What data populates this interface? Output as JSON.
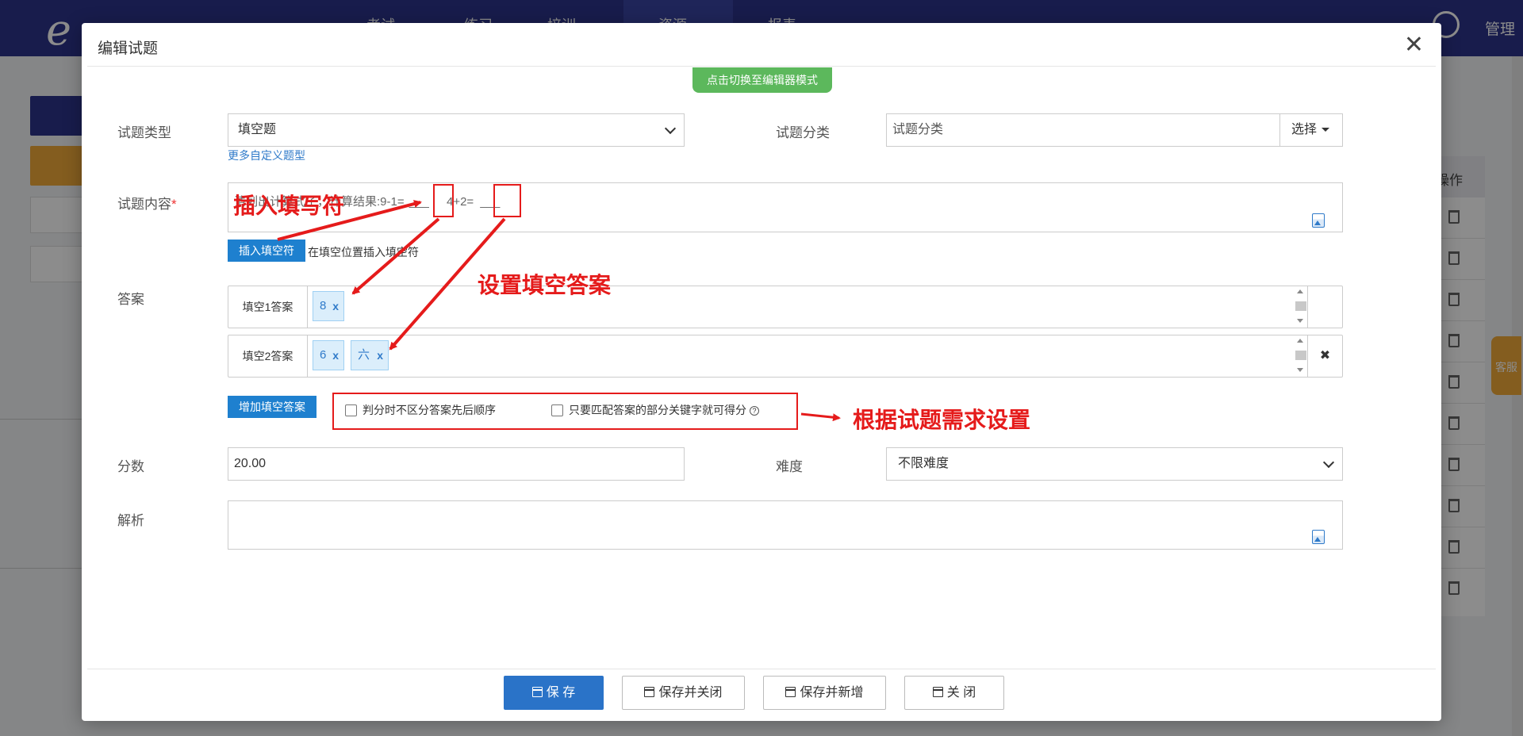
{
  "background": {
    "logo": "e",
    "nav_items": [
      "考试",
      "练习",
      "培训",
      "资源",
      "报表"
    ],
    "admin": "管理",
    "kefu": "客服",
    "right_header": "操作"
  },
  "modal": {
    "title": "编辑试题",
    "close": "✕",
    "switch_mode": "点击切换至编辑器模式"
  },
  "form": {
    "type_label": "试题类型",
    "type_value": "填空题",
    "more_types_link": "更多自定义题型",
    "category_label": "试题分类",
    "category_placeholder": "试题分类",
    "choose_label": "选择",
    "content_label": "试题内容",
    "content_required": "*",
    "content_text": "请列出计算式子，计算结果:9-1=",
    "content_text2": "4+2=",
    "blank_placeholder": "___",
    "insert_blank_btn": "插入填空符",
    "insert_blank_hint": "在填空位置插入填空符",
    "answer_label": "答案",
    "answers": [
      {
        "label": "填空1答案",
        "tags": [
          "8"
        ]
      },
      {
        "label": "填空2答案",
        "tags": [
          "6",
          "六"
        ]
      }
    ],
    "tag_remove": "x",
    "remove_row": "✖",
    "add_answer_btn": "增加填空答案",
    "option_unordered": "判分时不区分答案先后顺序",
    "option_keyword": "只要匹配答案的部分关键字就可得分",
    "score_label": "分数",
    "score_value": "20.00",
    "difficulty_label": "难度",
    "difficulty_value": "不限难度",
    "analysis_label": "解析"
  },
  "annotations": {
    "insert_blank": "插入填写符",
    "set_answer": "设置填空答案",
    "by_need": "根据试题需求设置",
    "color": "#e51b1b"
  },
  "footer": {
    "save": "保 存",
    "save_close": "保存并关闭",
    "save_new": "保存并新增",
    "close": "关 闭"
  }
}
